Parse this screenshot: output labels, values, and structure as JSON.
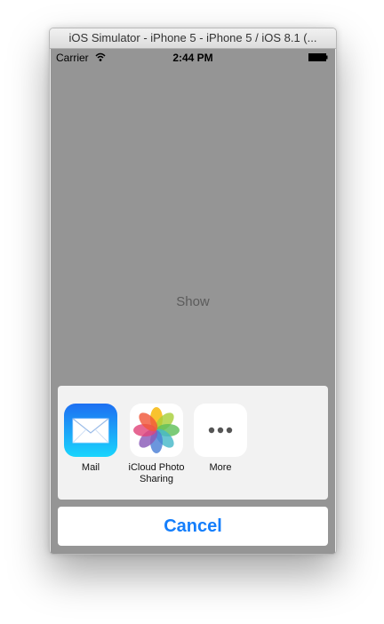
{
  "window": {
    "title": "iOS Simulator - iPhone 5 - iPhone 5 / iOS 8.1 (..."
  },
  "status_bar": {
    "carrier": "Carrier",
    "time": "2:44 PM"
  },
  "main": {
    "show_label": "Show"
  },
  "share_sheet": {
    "items": [
      {
        "label": "Mail",
        "icon": "mail-icon"
      },
      {
        "label": "iCloud Photo Sharing",
        "icon": "photos-icon"
      },
      {
        "label": "More",
        "icon": "more-icon"
      }
    ],
    "cancel_label": "Cancel"
  },
  "colors": {
    "accent": "#147efb",
    "dim_overlay": "#959595",
    "sheet_background": "#f2f2f2"
  }
}
